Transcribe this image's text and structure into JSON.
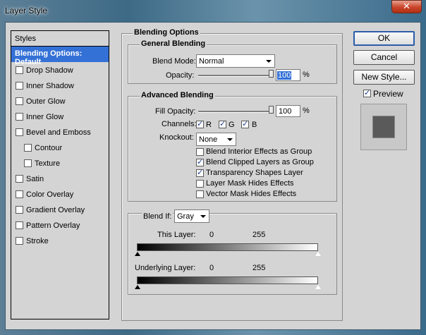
{
  "window": {
    "title": "Layer Style"
  },
  "styles": {
    "header": "Styles",
    "items": [
      {
        "label": "Blending Options: Default",
        "selected": true
      },
      {
        "label": "Drop Shadow",
        "checked": false
      },
      {
        "label": "Inner Shadow",
        "checked": false
      },
      {
        "label": "Outer Glow",
        "checked": false
      },
      {
        "label": "Inner Glow",
        "checked": false
      },
      {
        "label": "Bevel and Emboss",
        "checked": false
      },
      {
        "label": "Contour",
        "checked": false
      },
      {
        "label": "Texture",
        "checked": false
      },
      {
        "label": "Satin",
        "checked": false
      },
      {
        "label": "Color Overlay",
        "checked": false
      },
      {
        "label": "Gradient Overlay",
        "checked": false
      },
      {
        "label": "Pattern Overlay",
        "checked": false
      },
      {
        "label": "Stroke",
        "checked": false
      }
    ]
  },
  "blending": {
    "title": "Blending Options",
    "general": {
      "title": "General Blending",
      "blend_mode_label": "Blend Mode:",
      "blend_mode": "Normal",
      "opacity_label": "Opacity:",
      "opacity": "100",
      "opacity_unit": "%",
      "opacity_level": 1.0
    },
    "advanced": {
      "title": "Advanced Blending",
      "fill_label": "Fill Opacity:",
      "fill": "100",
      "fill_unit": "%",
      "fill_level": 1.0,
      "channels_label": "Channels:",
      "channels": [
        {
          "label": "R",
          "checked": true
        },
        {
          "label": "G",
          "checked": true
        },
        {
          "label": "B",
          "checked": true
        }
      ],
      "knockout_label": "Knockout:",
      "knockout": "None",
      "options": [
        {
          "label": "Blend Interior Effects as Group",
          "checked": false
        },
        {
          "label": "Blend Clipped Layers as Group",
          "checked": true
        },
        {
          "label": "Transparency Shapes Layer",
          "checked": true
        },
        {
          "label": "Layer Mask Hides Effects",
          "checked": false
        },
        {
          "label": "Vector Mask Hides Effects",
          "checked": false
        }
      ]
    },
    "blend_if": {
      "label": "Blend If:",
      "value": "Gray",
      "this_layer_label": "This Layer:",
      "this_layer_min": "0",
      "this_layer_max": "255",
      "underlying_label": "Underlying Layer:",
      "underlying_min": "0",
      "underlying_max": "255"
    }
  },
  "buttons": {
    "ok": "OK",
    "cancel": "Cancel",
    "new_style": "New Style..."
  },
  "preview": {
    "label": "Preview",
    "checked": true
  },
  "colors": {
    "selection": "#3471d6",
    "dialog_bg": "#d4d4d4",
    "swatch": "#5a5a5a"
  }
}
